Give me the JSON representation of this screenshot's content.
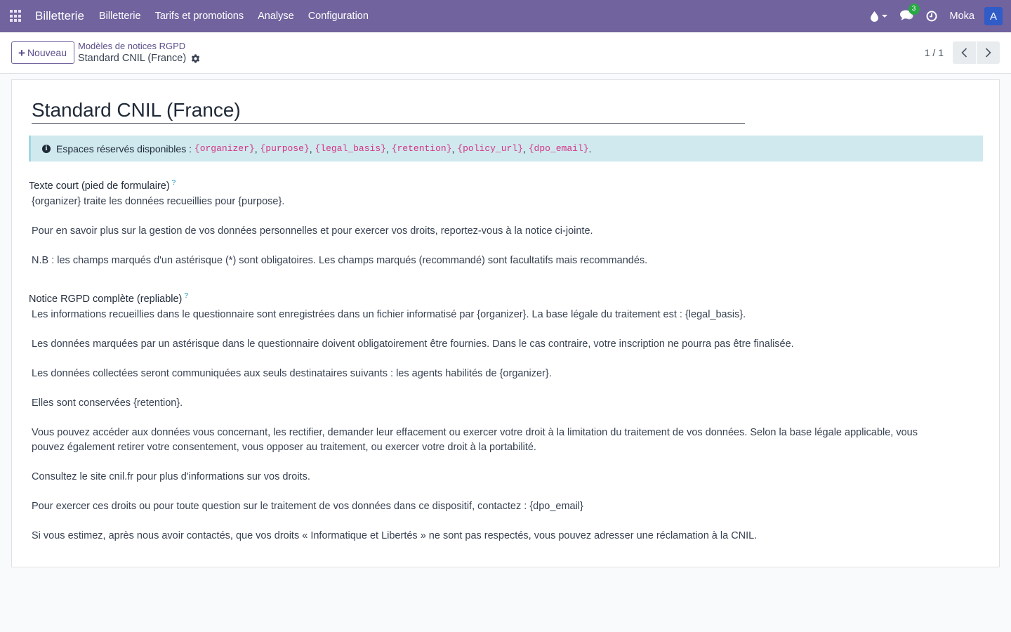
{
  "navbar": {
    "brand": "Billetterie",
    "menu": [
      "Billetterie",
      "Tarifs et promotions",
      "Analyse",
      "Configuration"
    ],
    "chat_count": "3",
    "username": "Moka",
    "avatar_letter": "A",
    "icons": [
      "apps-grid-icon",
      "water-drop-icon",
      "chat-icon",
      "clock-icon"
    ]
  },
  "control": {
    "new_label": "Nouveau",
    "breadcrumb_parent": "Modèles de notices RGPD",
    "breadcrumb_current": "Standard CNIL (France)",
    "pager": "1 / 1"
  },
  "form": {
    "title": "Standard CNIL (France)",
    "alert_prefix": "Espaces réservés disponibles :",
    "placeholders": [
      "{organizer}",
      "{purpose}",
      "{legal_basis}",
      "{retention}",
      "{policy_url}",
      "{dpo_email}"
    ],
    "short_label": "Texte court (pied de formulaire)",
    "short_text": [
      "{organizer} traite les données recueillies pour {purpose}.",
      "Pour en savoir plus sur la gestion de vos données personnelles et pour exercer vos droits, reportez-vous à la notice ci-jointe.",
      "N.B : les champs marqués d'un astérisque (*) sont obligatoires. Les champs marqués (recommandé) sont facultatifs mais recommandés."
    ],
    "full_label": "Notice RGPD complète (repliable)",
    "full_text": [
      "Les informations recueillies dans le questionnaire sont enregistrées dans un fichier informatisé par {organizer}. La base légale du traitement est : {legal_basis}.",
      "Les données marquées par un astérisque dans le questionnaire doivent obligatoirement être fournies. Dans le cas contraire, votre inscription ne pourra pas être finalisée.",
      "Les données collectées seront communiquées aux seuls destinataires suivants : les agents habilités de {organizer}.",
      "Elles sont conservées {retention}.",
      "Vous pouvez accéder aux données vous concernant, les rectifier, demander leur effacement ou exercer votre droit à la limitation du traitement de vos données. Selon la base légale applicable, vous pouvez également retirer votre consentement, vous opposer au traitement, ou exercer votre droit à la portabilité.",
      "Consultez le site cnil.fr pour plus d'informations sur vos droits.",
      "Pour exercer ces droits ou pour toute question sur le traitement de vos données dans ce dispositif, contactez : {dpo_email}",
      "Si vous estimez, après nous avoir contactés, que vos droits « Informatique et Libertés » ne sont pas respectés, vous pouvez adresser une réclamation à la CNIL."
    ],
    "help_marker": "?"
  },
  "colors": {
    "navbar": "#71639e",
    "alert_bg": "#cfe9ef",
    "placeholder_code": "#d63384",
    "avatar": "#2f5cc7",
    "badge": "#28a745"
  }
}
